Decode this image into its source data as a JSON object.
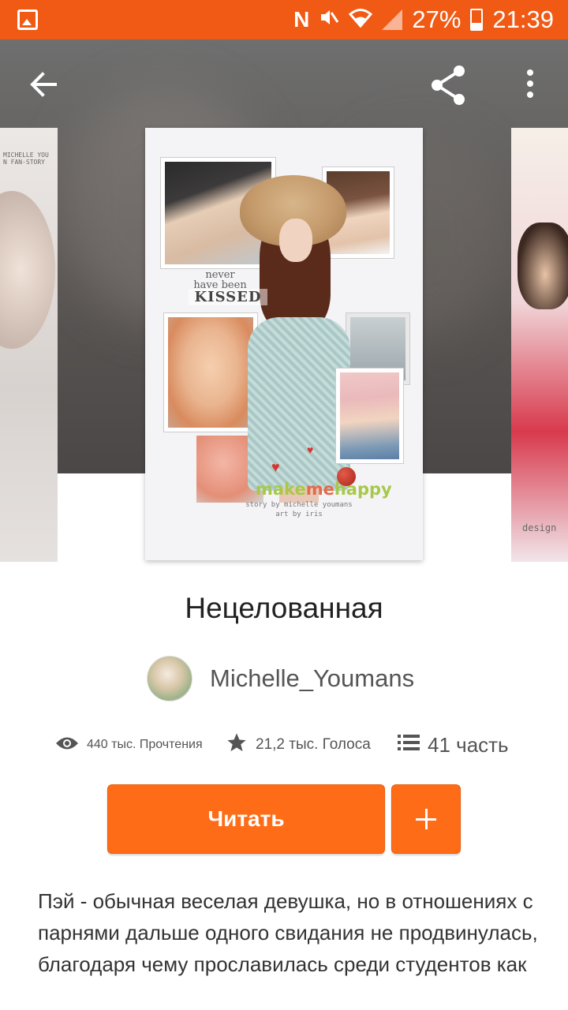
{
  "status_bar": {
    "n_label": "N",
    "battery": "27%",
    "time": "21:39",
    "icons": [
      "gallery-icon",
      "nfc-icon",
      "mute-icon",
      "wifi-icon",
      "signal-icon",
      "battery-icon"
    ]
  },
  "toolbar": {
    "back_icon": "arrow-back-icon",
    "share_icon": "share-icon",
    "more_icon": "more-vert-icon"
  },
  "cover": {
    "never_line1": "never",
    "never_line2": "have been",
    "kissed": "KISSED",
    "make": "make",
    "me": "me",
    "happy": "happy",
    "credit_line1": "story by michelle youmans",
    "credit_line2": "art by iris",
    "left_side_text1": "MICHELLE YOU",
    "left_side_text2": "N FAN-STORY",
    "right_side_text": "design"
  },
  "book": {
    "title": "Нецелованная",
    "author": "Michelle_Youmans",
    "reads": "440 тыс. Прочтения",
    "votes": "21,2 тыс. Голоса",
    "parts": "41 часть",
    "read_button": "Читать",
    "description": "Пэй - обычная веселая девушка, но в отношениях с парнями дальше одного свидания не продвинулась, благодаря чему прославилась среди студентов как"
  },
  "colors": {
    "status_bar": "#f05a14",
    "accent": "#ff6c17"
  }
}
